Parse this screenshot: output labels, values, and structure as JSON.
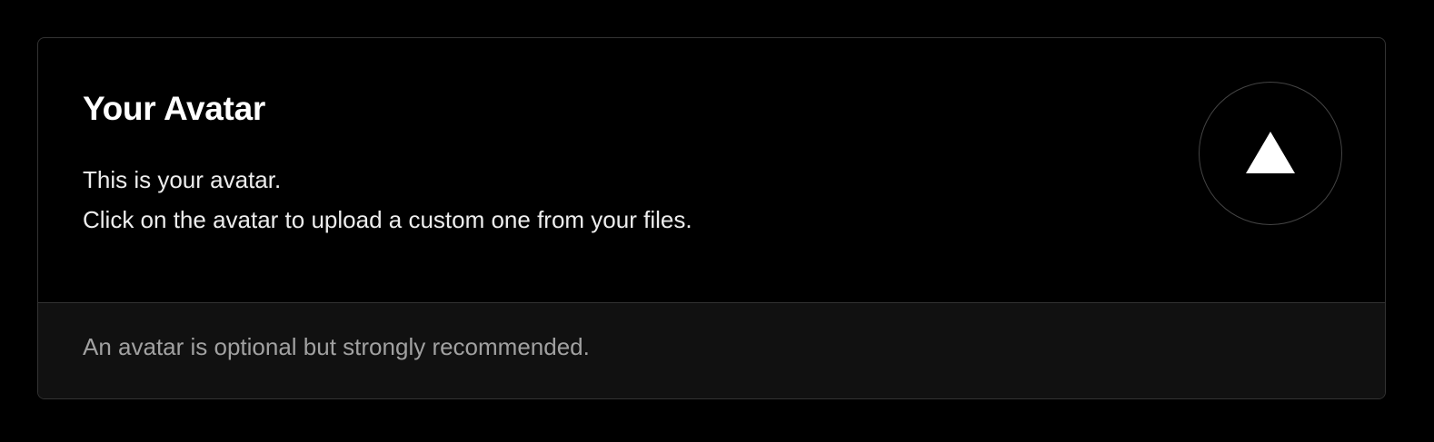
{
  "avatar_card": {
    "title": "Your Avatar",
    "description_lines": [
      "This is your avatar.",
      "Click on the avatar to upload a custom one from your files."
    ],
    "avatar_icon": "triangle-logo-icon",
    "footer_text": "An avatar is optional but strongly recommended."
  },
  "colors": {
    "background": "#000000",
    "card_border": "#333333",
    "footer_background": "#111111",
    "title_text": "#ffffff",
    "body_text": "#ededed",
    "muted_text": "#a1a1a1"
  }
}
